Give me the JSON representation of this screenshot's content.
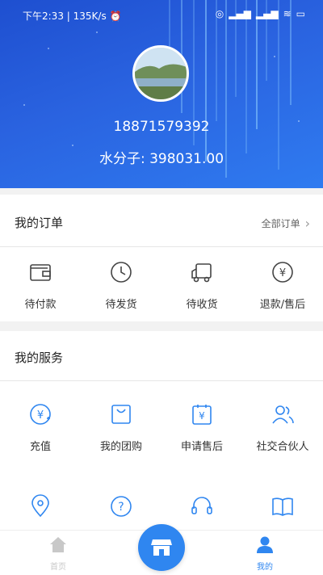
{
  "status_bar": {
    "time": "下午2:33",
    "speed": "135K/s"
  },
  "profile": {
    "phone": "18871579392",
    "points_label": "水分子:",
    "points_value": "398031.00"
  },
  "orders": {
    "title": "我的订单",
    "all_label": "全部订单",
    "items": [
      {
        "label": "待付款",
        "icon": "wallet-icon"
      },
      {
        "label": "待发货",
        "icon": "clock-icon"
      },
      {
        "label": "待收货",
        "icon": "truck-icon"
      },
      {
        "label": "退款/售后",
        "icon": "refund-icon"
      }
    ]
  },
  "services": {
    "title": "我的服务",
    "items": [
      {
        "label": "充值",
        "icon": "recharge-icon"
      },
      {
        "label": "我的团购",
        "icon": "group-buy-icon"
      },
      {
        "label": "申请售后",
        "icon": "after-sale-icon"
      },
      {
        "label": "社交合伙人",
        "icon": "partners-icon"
      }
    ],
    "row2_icons": [
      "location-icon",
      "help-icon",
      "headset-icon",
      "book-icon"
    ]
  },
  "tabbar": {
    "home_label": "首页",
    "mine_label": "我的"
  },
  "colors": {
    "accent": "#2f86f0",
    "header_start": "#1e4fd0",
    "header_end": "#2f7bf0",
    "tab_inactive": "#c8c8c8"
  }
}
